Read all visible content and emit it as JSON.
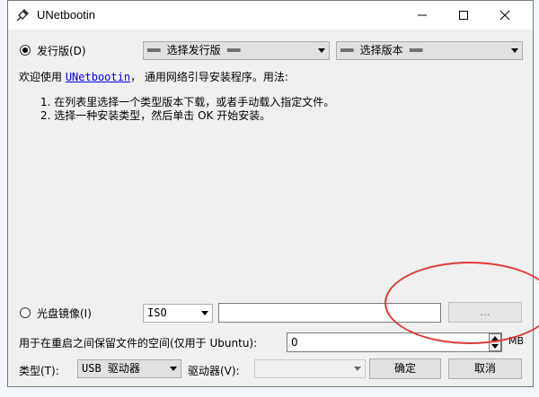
{
  "window": {
    "title": "UNetbootin",
    "minimize_glyph": "—",
    "maximize_glyph": "☐",
    "close_glyph": "✕"
  },
  "distro": {
    "radio_label": "发行版(D)",
    "selected": true,
    "distro_combo": "══ 选择发行版 ══",
    "version_combo": "══ 选择版本 ══"
  },
  "info": {
    "welcome_prefix": "欢迎使用 ",
    "welcome_link": "UNetbootin",
    "welcome_suffix": "， 通用网络引导安装程序。用法:",
    "step1": "1. 在列表里选择一个类型版本下载，或者手动载入指定文件。",
    "step2": "2. 选择一种安装类型，然后单击 OK 开始安装。"
  },
  "diskimage": {
    "radio_label": "光盘镜像(I)",
    "selected": false,
    "type_combo": "ISO",
    "path_value": "",
    "browse_label": "..."
  },
  "persistence": {
    "label": "用于在重启之间保留文件的空间(仅用于 Ubuntu):",
    "value": "0",
    "unit": "MB"
  },
  "bottom": {
    "type_label": "类型(T):",
    "type_combo": "USB 驱动器",
    "drive_label": "驱动器(V):",
    "drive_combo": "",
    "ok_label": "确定",
    "cancel_label": "取消"
  },
  "colors": {
    "annotation": "#e03a3a",
    "link": "#0000ee"
  }
}
